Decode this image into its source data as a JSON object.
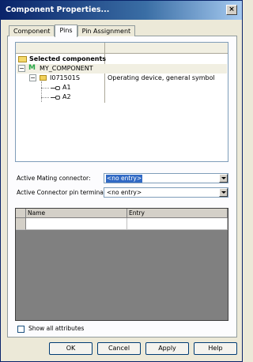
{
  "window": {
    "title": "Component Properties..."
  },
  "tabs": [
    "Component",
    "Pins",
    "Pin Assignment"
  ],
  "tree": {
    "header": "Selected components",
    "component": "MY_COMPONENT",
    "device": {
      "name": "I071501S",
      "description": "Operating device, general symbol"
    },
    "pins": [
      "A1",
      "A2"
    ]
  },
  "fields": {
    "mating_label": "Active Mating connector:",
    "mating_value": "<no entry>",
    "pin_terminal_label": "Active Connector pin terminal:",
    "pin_terminal_value": "<no entry>"
  },
  "grid": {
    "columns": [
      "Name",
      "Entry"
    ]
  },
  "show_all": "Show all attributes",
  "buttons": {
    "ok": "OK",
    "cancel": "Cancel",
    "apply": "Apply",
    "help": "Help"
  }
}
